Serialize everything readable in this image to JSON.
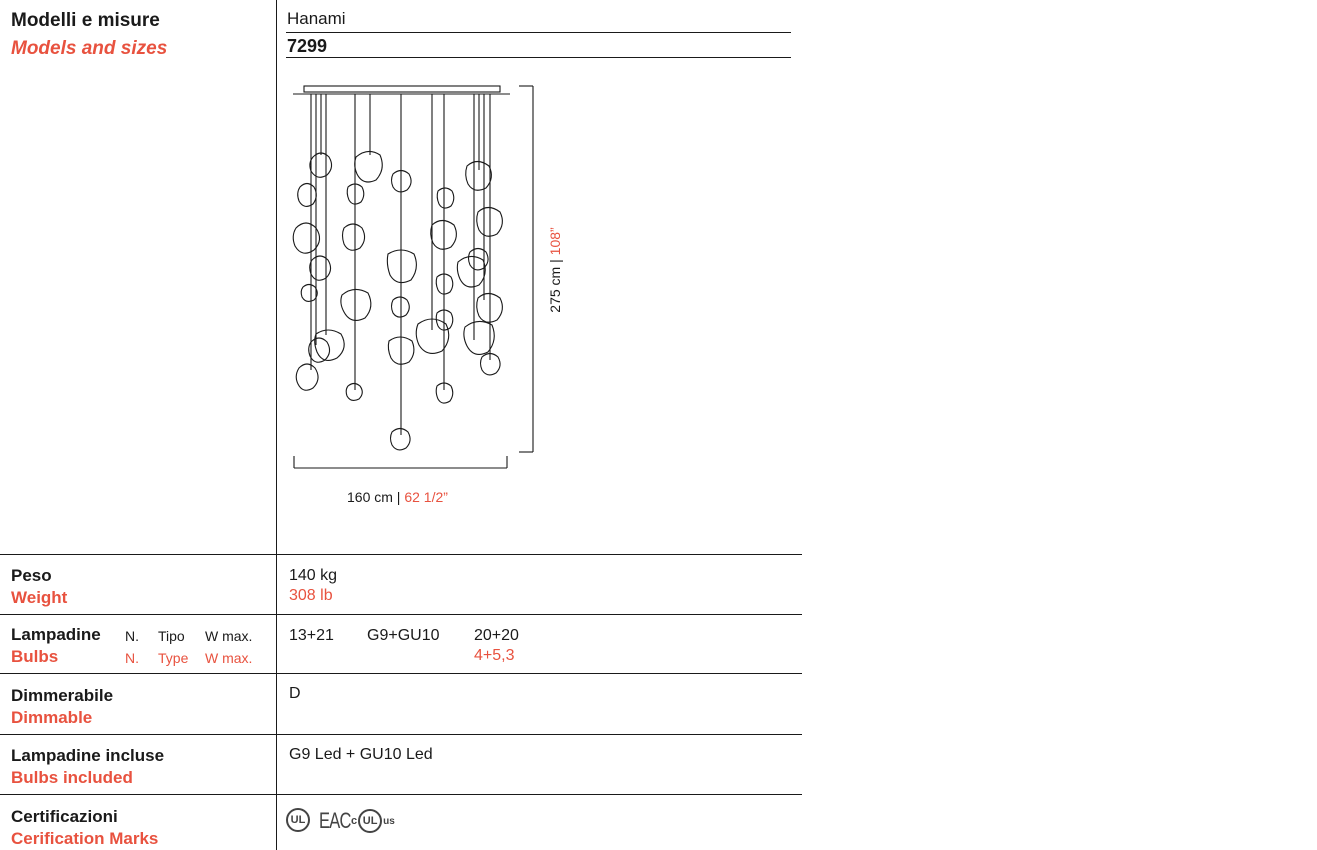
{
  "header": {
    "title_it": "Modelli e misure",
    "title_en": "Models and sizes",
    "product_name": "Hanami",
    "model_code": "7299"
  },
  "drawing": {
    "height_cm": "275 cm",
    "height_in": "108”",
    "width_cm": "160 cm",
    "width_in": "62 1/2”",
    "separator": " | "
  },
  "specs": {
    "weight": {
      "label_it": "Peso",
      "label_en": "Weight",
      "value_kg": "140 kg",
      "value_lb": "308 lb"
    },
    "bulbs": {
      "label_it": "Lampadine",
      "label_en": "Bulbs",
      "col_n_it": "N.",
      "col_type_it": "Tipo",
      "col_w_it": "W max.",
      "col_n_en": "N.",
      "col_type_en": "Type",
      "col_w_en": "W max.",
      "n": "13+21",
      "type": "G9+GU10",
      "w_max": "20+20",
      "w_max_alt": "4+5,3"
    },
    "dimmable": {
      "label_it": "Dimmerabile",
      "label_en": "Dimmable",
      "value": "D"
    },
    "included": {
      "label_it": "Lampadine incluse",
      "label_en": "Bulbs included",
      "value": "G9 Led + GU10 Led"
    },
    "certs": {
      "label_it": "Certificazioni",
      "label_en": "Cerification Marks",
      "ul": "UL",
      "eac": "EAC",
      "cul_c": "c",
      "cul_us": "us"
    }
  }
}
